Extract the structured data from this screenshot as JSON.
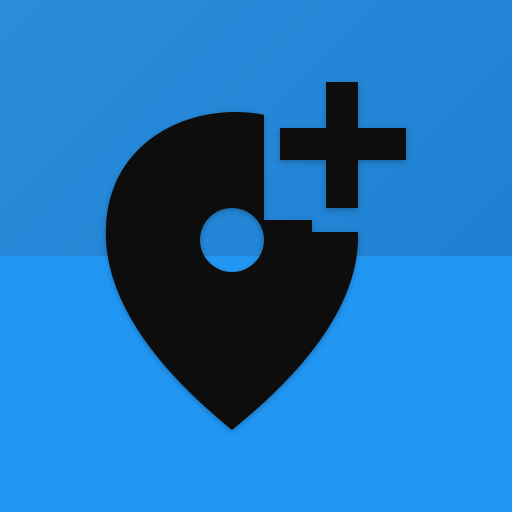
{
  "icon": {
    "name": "add-location-icon",
    "glyphs": [
      "map-pin-icon",
      "plus-icon"
    ]
  },
  "colors": {
    "background_bottom": "#2196F3",
    "background_top": "#1F84D6",
    "glyph_fill": "#0a0a0a"
  }
}
